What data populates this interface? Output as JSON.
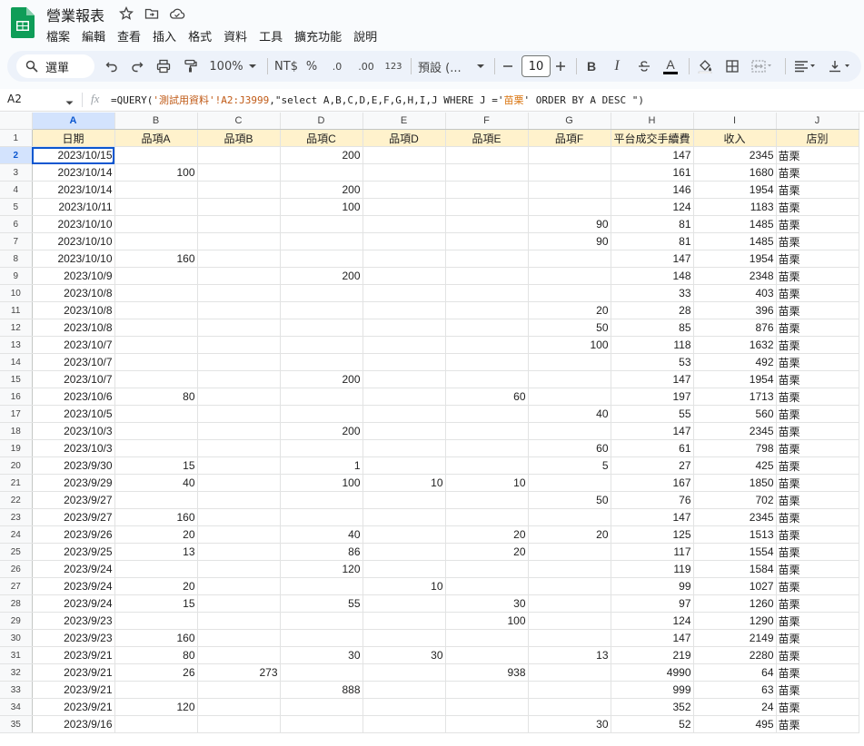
{
  "doc": {
    "title": "營業報表"
  },
  "menu": [
    "檔案",
    "編輯",
    "查看",
    "插入",
    "格式",
    "資料",
    "工具",
    "擴充功能",
    "說明"
  ],
  "toolbar": {
    "search_label": "選單",
    "zoom": "100%",
    "currency": "NT$",
    "percent": "%",
    "dec_decrease": ".0",
    "dec_increase": ".00",
    "number_format": "123",
    "font_name": "預設 (...",
    "font_size": "10",
    "bold": "B",
    "italic": "I",
    "text_color_letter": "A"
  },
  "formula_bar": {
    "cell_ref": "A2",
    "fx": "fx",
    "formula_prefix": "=QUERY(",
    "formula_range": "'測試用資料'!A2:J3999",
    "formula_sep": ",",
    "formula_query_a": "\"select A,B,C,D,E,F,G,H,I,J  WHERE J ='",
    "formula_query_b": "苗栗",
    "formula_query_c": "' ORDER BY A DESC \")"
  },
  "grid": {
    "columns": [
      "A",
      "B",
      "C",
      "D",
      "E",
      "F",
      "G",
      "H",
      "I",
      "J"
    ],
    "header_row": [
      "日期",
      "品項A",
      "品項B",
      "品項C",
      "品項D",
      "品項E",
      "品項F",
      "平台成交手續費",
      "收入",
      "店別"
    ],
    "rows": [
      [
        "2023/10/15",
        "",
        "",
        "200",
        "",
        "",
        "",
        "147",
        "2345",
        "苗栗"
      ],
      [
        "2023/10/14",
        "100",
        "",
        "",
        "",
        "",
        "",
        "161",
        "1680",
        "苗栗"
      ],
      [
        "2023/10/14",
        "",
        "",
        "200",
        "",
        "",
        "",
        "146",
        "1954",
        "苗栗"
      ],
      [
        "2023/10/11",
        "",
        "",
        "100",
        "",
        "",
        "",
        "124",
        "1183",
        "苗栗"
      ],
      [
        "2023/10/10",
        "",
        "",
        "",
        "",
        "",
        "90",
        "81",
        "1485",
        "苗栗"
      ],
      [
        "2023/10/10",
        "",
        "",
        "",
        "",
        "",
        "90",
        "81",
        "1485",
        "苗栗"
      ],
      [
        "2023/10/10",
        "160",
        "",
        "",
        "",
        "",
        "",
        "147",
        "1954",
        "苗栗"
      ],
      [
        "2023/10/9",
        "",
        "",
        "200",
        "",
        "",
        "",
        "148",
        "2348",
        "苗栗"
      ],
      [
        "2023/10/8",
        "",
        "",
        "",
        "",
        "",
        "",
        "33",
        "403",
        "苗栗"
      ],
      [
        "2023/10/8",
        "",
        "",
        "",
        "",
        "",
        "20",
        "28",
        "396",
        "苗栗"
      ],
      [
        "2023/10/8",
        "",
        "",
        "",
        "",
        "",
        "50",
        "85",
        "876",
        "苗栗"
      ],
      [
        "2023/10/7",
        "",
        "",
        "",
        "",
        "",
        "100",
        "118",
        "1632",
        "苗栗"
      ],
      [
        "2023/10/7",
        "",
        "",
        "",
        "",
        "",
        "",
        "53",
        "492",
        "苗栗"
      ],
      [
        "2023/10/7",
        "",
        "",
        "200",
        "",
        "",
        "",
        "147",
        "1954",
        "苗栗"
      ],
      [
        "2023/10/6",
        "80",
        "",
        "",
        "",
        "60",
        "",
        "197",
        "1713",
        "苗栗"
      ],
      [
        "2023/10/5",
        "",
        "",
        "",
        "",
        "",
        "40",
        "55",
        "560",
        "苗栗"
      ],
      [
        "2023/10/3",
        "",
        "",
        "200",
        "",
        "",
        "",
        "147",
        "2345",
        "苗栗"
      ],
      [
        "2023/10/3",
        "",
        "",
        "",
        "",
        "",
        "60",
        "61",
        "798",
        "苗栗"
      ],
      [
        "2023/9/30",
        "15",
        "",
        "1",
        "",
        "",
        "5",
        "27",
        "425",
        "苗栗"
      ],
      [
        "2023/9/29",
        "40",
        "",
        "100",
        "10",
        "10",
        "",
        "167",
        "1850",
        "苗栗"
      ],
      [
        "2023/9/27",
        "",
        "",
        "",
        "",
        "",
        "50",
        "76",
        "702",
        "苗栗"
      ],
      [
        "2023/9/27",
        "160",
        "",
        "",
        "",
        "",
        "",
        "147",
        "2345",
        "苗栗"
      ],
      [
        "2023/9/26",
        "20",
        "",
        "40",
        "",
        "20",
        "20",
        "125",
        "1513",
        "苗栗"
      ],
      [
        "2023/9/25",
        "13",
        "",
        "86",
        "",
        "20",
        "",
        "117",
        "1554",
        "苗栗"
      ],
      [
        "2023/9/24",
        "",
        "",
        "120",
        "",
        "",
        "",
        "119",
        "1584",
        "苗栗"
      ],
      [
        "2023/9/24",
        "20",
        "",
        "",
        "10",
        "",
        "",
        "99",
        "1027",
        "苗栗"
      ],
      [
        "2023/9/24",
        "15",
        "",
        "55",
        "",
        "30",
        "",
        "97",
        "1260",
        "苗栗"
      ],
      [
        "2023/9/23",
        "",
        "",
        "",
        "",
        "100",
        "",
        "124",
        "1290",
        "苗栗"
      ],
      [
        "2023/9/23",
        "160",
        "",
        "",
        "",
        "",
        "",
        "147",
        "2149",
        "苗栗"
      ],
      [
        "2023/9/21",
        "80",
        "",
        "30",
        "30",
        "",
        "13",
        "219",
        "2280",
        "苗栗"
      ],
      [
        "2023/9/21",
        "26",
        "273",
        "",
        "",
        "938",
        "",
        "4990",
        "64",
        "苗栗"
      ],
      [
        "2023/9/21",
        "",
        "",
        "888",
        "",
        "",
        "",
        "999",
        "63",
        "苗栗"
      ],
      [
        "2023/9/21",
        "120",
        "",
        "",
        "",
        "",
        "",
        "352",
        "24",
        "苗栗"
      ],
      [
        "2023/9/16",
        "",
        "",
        "",
        "",
        "",
        "30",
        "52",
        "495",
        "苗栗"
      ]
    ]
  }
}
